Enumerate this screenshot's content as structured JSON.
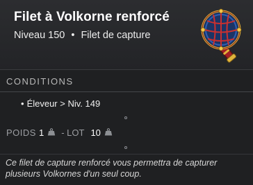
{
  "item": {
    "name": "Filet à Volkorne renforcé",
    "level": "Niveau 150",
    "separator": "•",
    "type": "Filet de capture",
    "icon": "capture-net-icon"
  },
  "conditions": {
    "header": "CONDITIONS",
    "items": [
      {
        "bullet": "•",
        "text": "Éleveur > Niv. 149"
      }
    ]
  },
  "stats": {
    "weight_label": "POIDS",
    "weight_value": "1",
    "separator": "- LOT",
    "lot_value": "10",
    "weight_icon": "weight-icon"
  },
  "description": "Ce filet de capture renforcé vous permettra de capturer plusieurs Volkornes d'un seul coup.",
  "colors": {
    "background": "#1f2022",
    "title": "#ffffff",
    "muted": "#9c9ea2",
    "net_red": "#b8242a",
    "net_gold": "#e1b53c",
    "net_blue": "#2d5fb4"
  }
}
